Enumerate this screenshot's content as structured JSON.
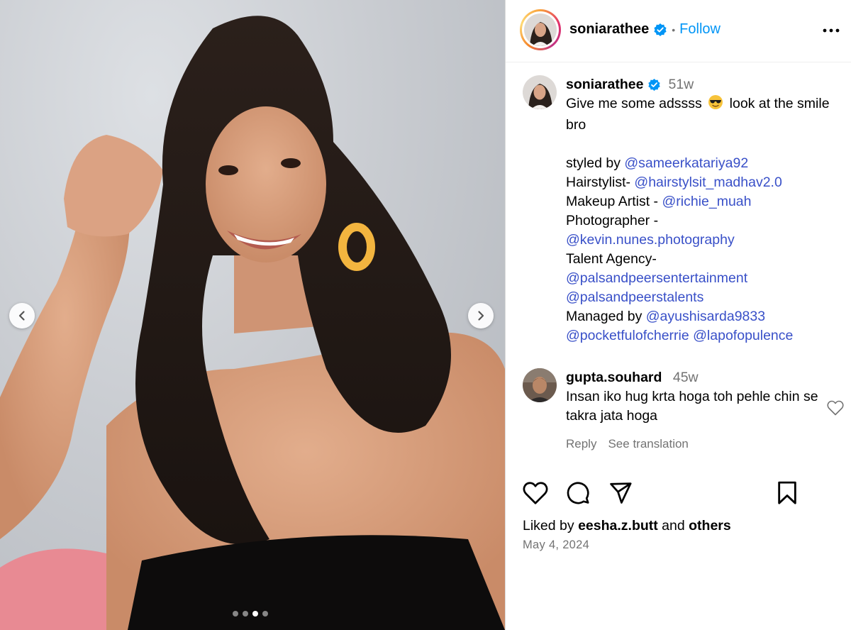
{
  "post": {
    "username": "soniarathee",
    "follow_label": "Follow",
    "separator": "•"
  },
  "caption": {
    "username": "soniarathee",
    "time": "51w",
    "line1_a": "Give me some adssss",
    "line1_b": "look at the smile",
    "line2": "bro",
    "styled_label": "styled by",
    "styled_mention": "@sameerkatariya92",
    "hair_label": "Hairstylist-",
    "hair_mention": "@hairstylsit_madhav2.0",
    "makeup_label": "Makeup Artist -",
    "makeup_mention": "@richie_muah",
    "photo_label": "Photographer -",
    "photo_mention": "@kevin.nunes.photography",
    "agency_label": "Talent Agency-",
    "agency_mention1": "@palsandpeersentertainment",
    "agency_mention2": "@palsandpeerstalents",
    "managed_label": "Managed by",
    "managed_mention1": "@ayushisarda9833",
    "managed_mention2": "@pocketfulofcherrie",
    "managed_mention3": "@lapofopulence"
  },
  "comment": {
    "username": "gupta.souhard",
    "time": "45w",
    "text": "Insan iko hug krta hoga toh pehle chin se takra jata hoga",
    "reply_label": "Reply",
    "translate_label": "See translation"
  },
  "likes": {
    "prefix": "Liked by",
    "user": "eesha.z.butt",
    "conj": "and",
    "others": "others"
  },
  "date": "May 4, 2024",
  "carousel": {
    "slide_count": 4,
    "active_index": 2
  },
  "icons": {
    "verified": "verified-badge-icon",
    "more": "more-options-icon",
    "heart": "heart-icon",
    "comment": "comment-icon",
    "share": "share-icon",
    "save": "bookmark-icon",
    "prev": "chevron-left-icon",
    "next": "chevron-right-icon",
    "emoji": "sunglasses-emoji"
  },
  "colors": {
    "link": "#3950c8",
    "follow": "#0095f6",
    "verified": "#0095f6",
    "muted": "#737373"
  }
}
